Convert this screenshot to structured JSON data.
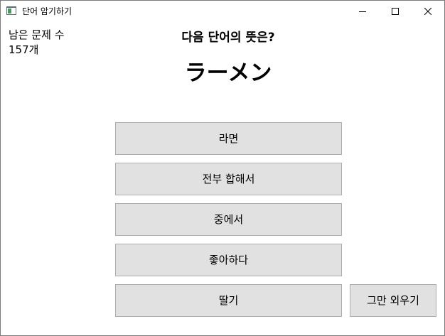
{
  "window": {
    "title": "단어 암기하기",
    "icon": "app-window-icon",
    "controls": [
      "minimize-icon",
      "maximize-icon",
      "close-icon"
    ]
  },
  "status": {
    "remaining_label": "남은 문제 수",
    "remaining_count": "157개"
  },
  "quiz": {
    "question": "다음 단어의 뜻은?",
    "word": "ラーメン",
    "choices": [
      {
        "label": "라면"
      },
      {
        "label": "전부 합해서"
      },
      {
        "label": "중에서"
      },
      {
        "label": "좋아하다"
      },
      {
        "label": "딸기"
      }
    ],
    "stop_label": "그만 외우기"
  }
}
